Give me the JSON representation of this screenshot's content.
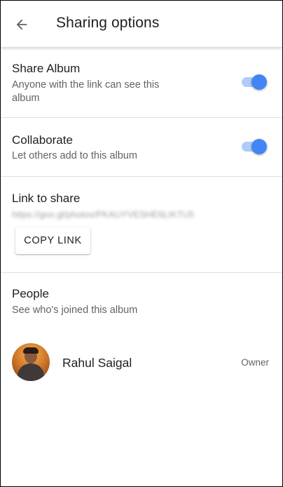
{
  "header": {
    "back_icon": "arrow-left-icon",
    "title": "Sharing options"
  },
  "share_album": {
    "title": "Share Album",
    "subtitle_line1": "Anyone with the link can see this",
    "subtitle_line2": "album",
    "toggle_on": true
  },
  "collaborate": {
    "title": "Collaborate",
    "subtitle": "Let others add to this album",
    "toggle_on": true
  },
  "link": {
    "title": "Link to share",
    "url": "https://goo.gl/photos/PKAUYVESHE6LIKTU5",
    "copy_label": "COPY LINK"
  },
  "people": {
    "title": "People",
    "subtitle": "See who's joined this album",
    "members": [
      {
        "name": "Rahul Saigal",
        "role": "Owner"
      }
    ]
  },
  "colors": {
    "accent": "#4285f4",
    "toggle_track": "#aecbfa",
    "text_primary": "#202124",
    "text_secondary": "#5f6368"
  }
}
